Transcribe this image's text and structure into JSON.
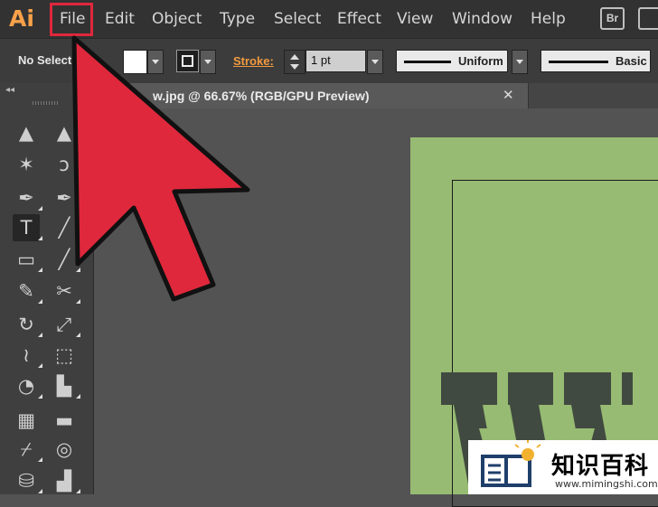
{
  "app": {
    "logo_text": "Ai"
  },
  "menu": {
    "items": [
      "File",
      "Edit",
      "Object",
      "Type",
      "Select",
      "Effect",
      "View",
      "Window",
      "Help"
    ],
    "highlighted": "File"
  },
  "bridge": {
    "br_label": "Br"
  },
  "control_bar": {
    "selection_status": "No Selection",
    "stroke_label": "Stroke:",
    "stroke_weight": "1 pt",
    "variable_width_profile": "Uniform",
    "brush_definition": "Basic"
  },
  "document_tab": {
    "title": "w.jpg @ 66.67% (RGB/GPU Preview)",
    "close_glyph": "✕"
  },
  "toolbox": {
    "collapse_glyph": "◂◂",
    "tools": [
      {
        "name": "selection-tool",
        "glyph": "▲"
      },
      {
        "name": "direct-selection-tool",
        "glyph": "▲"
      },
      {
        "name": "magic-wand-tool",
        "glyph": "✶"
      },
      {
        "name": "lasso-tool",
        "glyph": "ↄ"
      },
      {
        "name": "pen-tool",
        "glyph": "✒"
      },
      {
        "name": "curvature-tool",
        "glyph": "✒"
      },
      {
        "name": "type-tool",
        "glyph": "T"
      },
      {
        "name": "line-segment-tool",
        "glyph": "╱"
      },
      {
        "name": "rectangle-tool",
        "glyph": "▭"
      },
      {
        "name": "paintbrush-tool",
        "glyph": "╱"
      },
      {
        "name": "pencil-tool",
        "glyph": "✎"
      },
      {
        "name": "scissors-tool",
        "glyph": "✂"
      },
      {
        "name": "rotate-tool",
        "glyph": "↻"
      },
      {
        "name": "scale-tool",
        "glyph": "⤢"
      },
      {
        "name": "width-tool",
        "glyph": "≀"
      },
      {
        "name": "free-transform-tool",
        "glyph": "⬚"
      },
      {
        "name": "shape-builder-tool",
        "glyph": "◔"
      },
      {
        "name": "chart-tool",
        "glyph": "▙"
      },
      {
        "name": "mesh-tool",
        "glyph": "▦"
      },
      {
        "name": "gradient-tool",
        "glyph": "▬"
      },
      {
        "name": "eyedropper-tool",
        "glyph": "⌿"
      },
      {
        "name": "blend-tool",
        "glyph": "◎"
      },
      {
        "name": "symbol-sprayer-tool",
        "glyph": "⛁"
      },
      {
        "name": "column-graph-tool",
        "glyph": "▟"
      }
    ]
  },
  "watermark": {
    "text": "知识百科",
    "url": "www.mimingshi.com"
  },
  "colors": {
    "highlight": "#e0283c",
    "accent_orange": "#f39b3f",
    "artboard": "#97bb73",
    "artwork_letter": "#414a40"
  }
}
